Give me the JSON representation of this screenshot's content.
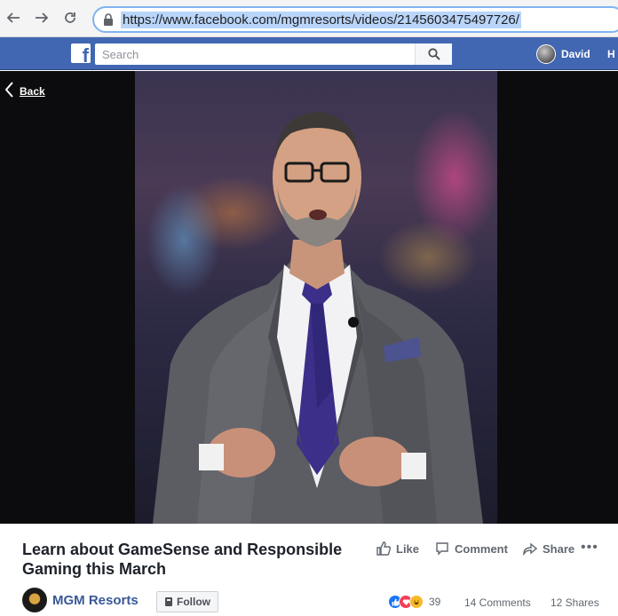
{
  "browser": {
    "url": "https://www.facebook.com/mgmresorts/videos/2145603475497726/"
  },
  "fb_header": {
    "logo_letter": "f",
    "search_placeholder": "Search",
    "user_name": "David",
    "home_label_partial": "H"
  },
  "video": {
    "back_label": "Back"
  },
  "post": {
    "title": "Learn about GameSense and Responsible Gaming this March",
    "actions": {
      "like": "Like",
      "comment": "Comment",
      "share": "Share"
    },
    "page_name": "MGM Resorts",
    "follow_label": "Follow",
    "reaction_count": "39",
    "comments": "14 Comments",
    "shares": "12 Shares"
  },
  "colors": {
    "fb_blue": "#4267b2",
    "link_blue": "#385898",
    "url_highlight": "#b9d5f9"
  }
}
